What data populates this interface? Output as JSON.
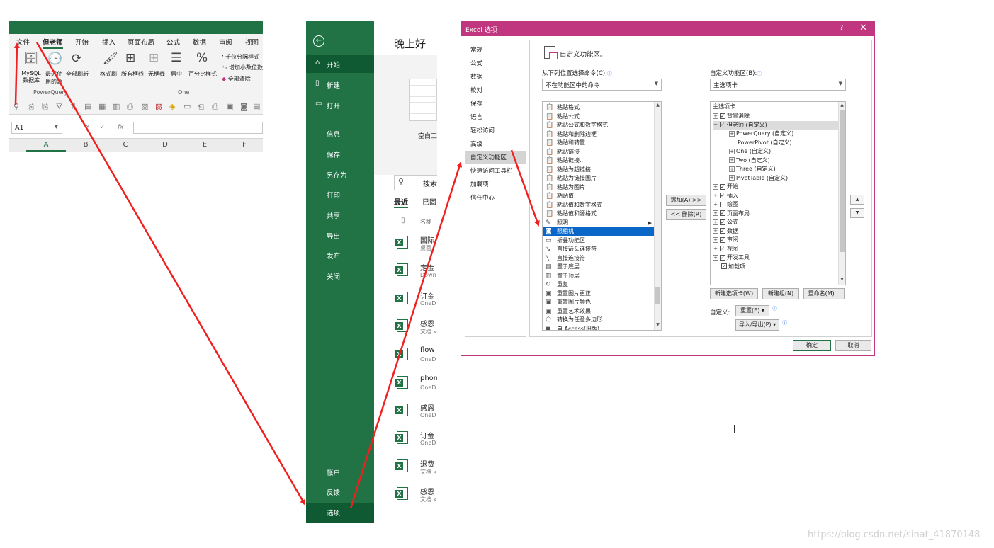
{
  "ribbon": {
    "tabs": [
      "文件",
      "但老师",
      "开始",
      "插入",
      "页面布局",
      "公式",
      "数据",
      "审阅",
      "视图"
    ],
    "active_tab": "但老师",
    "buttons": [
      {
        "label": "MySQL\n数据库",
        "icon": "database-icon"
      },
      {
        "label": "最近使\n用的源",
        "icon": "recent-source-icon"
      },
      {
        "label": "全部刷新",
        "icon": "refresh-icon"
      },
      {
        "label": "格式刷",
        "icon": "format-painter-icon"
      },
      {
        "label": "所有框线",
        "icon": "all-borders-icon"
      },
      {
        "label": "无框线",
        "icon": "no-border-icon"
      },
      {
        "label": "居中",
        "icon": "center-icon"
      },
      {
        "label": "百分比样式",
        "icon": "percent-icon"
      }
    ],
    "small_buttons": [
      "千位分隔样式",
      "增加小数位数",
      "全部清除"
    ],
    "group_labels": [
      "PowerQuery",
      "One"
    ],
    "name_box": "A1",
    "fx": "fx",
    "columns": [
      "A",
      "B",
      "C",
      "D",
      "E",
      "F"
    ]
  },
  "backstage": {
    "nav_top": [
      "开始",
      "新建",
      "打开"
    ],
    "nav_mid": [
      "信息",
      "保存",
      "另存为",
      "打印",
      "共享",
      "导出",
      "发布",
      "关闭"
    ],
    "nav_bottom": [
      "帐户",
      "反馈",
      "选项"
    ],
    "selected_nav": "选项",
    "greeting": "晚上好",
    "template_label": "空白工",
    "search_placeholder": "搜索",
    "recent_tabs": [
      "最近",
      "已固"
    ],
    "list_header": "名称",
    "files": [
      {
        "name": "国际",
        "loc": "桌面"
      },
      {
        "name": "定金",
        "loc": "Down"
      },
      {
        "name": "订金",
        "loc": "OneD"
      },
      {
        "name": "感恩",
        "loc": "文档 »"
      },
      {
        "name": "flow",
        "loc": "OneD"
      },
      {
        "name": "phon",
        "loc": "OneD"
      },
      {
        "name": "感恩",
        "loc": "OneD"
      },
      {
        "name": "订金",
        "loc": "OneD"
      },
      {
        "name": "退费",
        "loc": "文档 »"
      },
      {
        "name": "感恩",
        "loc": "文档 »"
      }
    ]
  },
  "dialog": {
    "title": "Excel 选项",
    "help": "?",
    "close": "✕",
    "nav_items": [
      "常规",
      "公式",
      "数据",
      "校对",
      "保存",
      "语言",
      "轻松访问",
      "高级",
      "自定义功能区",
      "快速访问工具栏",
      "加载项",
      "信任中心"
    ],
    "selected_nav": "自定义功能区",
    "header_title": "自定义功能区。",
    "choose_from_label": "从下列位置选择命令(C):",
    "choose_from_value": "不在功能区中的命令",
    "customize_label": "自定义功能区(B):",
    "customize_value": "主选项卡",
    "commands": [
      {
        "label": "粘贴格式",
        "icon": "paste-icon"
      },
      {
        "label": "粘贴公式",
        "icon": "paste-icon"
      },
      {
        "label": "粘贴公式和数字格式",
        "icon": "paste-icon"
      },
      {
        "label": "粘贴和删除边框",
        "icon": "paste-icon"
      },
      {
        "label": "粘贴和转置",
        "icon": "paste-icon"
      },
      {
        "label": "粘贴链接",
        "icon": "paste-icon"
      },
      {
        "label": "粘贴链接...",
        "icon": "paste-icon"
      },
      {
        "label": "粘贴为超链接",
        "icon": "paste-icon"
      },
      {
        "label": "粘贴为链接图片",
        "icon": "paste-icon"
      },
      {
        "label": "粘贴为图片",
        "icon": "paste-icon"
      },
      {
        "label": "粘贴值",
        "icon": "paste-icon"
      },
      {
        "label": "粘贴值和数字格式",
        "icon": "paste-icon"
      },
      {
        "label": "粘贴值和源格式",
        "icon": "paste-icon"
      },
      {
        "label": "照明",
        "icon": "lighting-icon"
      },
      {
        "label": "照相机",
        "icon": "camera-icon"
      },
      {
        "label": "折叠功能区",
        "icon": "collapse-icon"
      },
      {
        "label": "直接箭头连接符",
        "icon": "arrow-connector-icon"
      },
      {
        "label": "直接连接符",
        "icon": "line-connector-icon"
      },
      {
        "label": "置于底层",
        "icon": "send-back-icon"
      },
      {
        "label": "置于顶层",
        "icon": "bring-front-icon"
      },
      {
        "label": "重复",
        "icon": "repeat-icon"
      },
      {
        "label": "重置图片更正",
        "icon": "reset-picture-icon"
      },
      {
        "label": "重置图片颜色",
        "icon": "reset-picture-icon"
      },
      {
        "label": "重置艺术效果",
        "icon": "reset-picture-icon"
      },
      {
        "label": "转换为任意多边形",
        "icon": "polygon-icon"
      },
      {
        "label": "自 Access(旧版)",
        "icon": "access-icon"
      }
    ],
    "selected_command": "照相机",
    "tree_header": "主选项卡",
    "tree": [
      {
        "label": "背景消除",
        "level": 0,
        "expander": "⊞",
        "checked": true
      },
      {
        "label": "但老师 (自定义)",
        "level": 0,
        "expander": "⊟",
        "checked": true,
        "highlight": true
      },
      {
        "label": "PowerQuery (自定义)",
        "level": 1,
        "expander": "⊞"
      },
      {
        "label": "PowerPivot (自定义)",
        "level": 1,
        "expander": ""
      },
      {
        "label": "One (自定义)",
        "level": 1,
        "expander": "⊞"
      },
      {
        "label": "Two (自定义)",
        "level": 1,
        "expander": "⊞"
      },
      {
        "label": "Three (自定义)",
        "level": 1,
        "expander": "⊞"
      },
      {
        "label": "PivotTable (自定义)",
        "level": 1,
        "expander": "⊞"
      },
      {
        "label": "开始",
        "level": 0,
        "expander": "⊞",
        "checked": true
      },
      {
        "label": "插入",
        "level": 0,
        "expander": "⊞",
        "checked": true
      },
      {
        "label": "绘图",
        "level": 0,
        "expander": "⊞",
        "checked": false
      },
      {
        "label": "页面布局",
        "level": 0,
        "expander": "⊞",
        "checked": true
      },
      {
        "label": "公式",
        "level": 0,
        "expander": "⊞",
        "checked": true
      },
      {
        "label": "数据",
        "level": 0,
        "expander": "⊞",
        "checked": true
      },
      {
        "label": "审阅",
        "level": 0,
        "expander": "⊞",
        "checked": true
      },
      {
        "label": "视图",
        "level": 0,
        "expander": "⊞",
        "checked": true
      },
      {
        "label": "开发工具",
        "level": 0,
        "expander": "⊞",
        "checked": true
      },
      {
        "label": "加载项",
        "level": 0,
        "expander": "",
        "checked": true
      }
    ],
    "add_button": "添加(A) >>",
    "remove_button": "<< 删除(R)",
    "new_tab_button": "新建选项卡(W)",
    "new_group_button": "新建组(N)",
    "rename_button": "重命名(M)...",
    "customize_label2": "自定义:",
    "reset_button": "重置(E) ▾",
    "import_export_button": "导入/导出(P) ▾",
    "ok_button": "确定",
    "cancel_button": "取消",
    "move_up": "▲",
    "move_down": "▼"
  },
  "watermark": "https://blog.csdn.net/sinat_41870148",
  "colors": {
    "excel_green": "#217346",
    "backstage_highlight": "#0f5a33",
    "dialog_title": "#c0367f",
    "selection_blue": "#0a66c7",
    "annotation_arrow": "#f02020"
  }
}
